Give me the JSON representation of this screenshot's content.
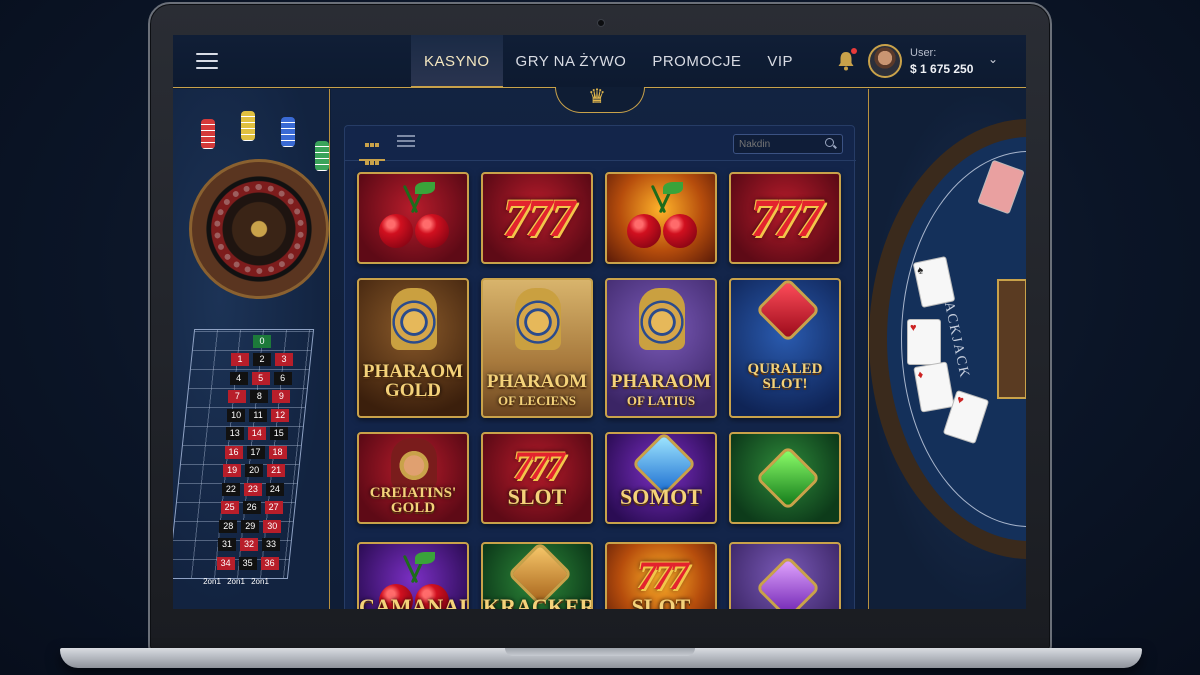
{
  "header": {
    "nav": [
      {
        "label": "KASYNO",
        "active": true
      },
      {
        "label": "GRY NA ŻYWO",
        "active": false
      },
      {
        "label": "PROMOCJE",
        "active": false
      },
      {
        "label": "VIP",
        "active": false
      }
    ],
    "user_label": "User:",
    "balance": "$ 1 675 250"
  },
  "toolbar": {
    "search_placeholder": "Nakdin"
  },
  "left_table": {
    "zero": "0",
    "numbers": [
      "1",
      "2",
      "3",
      "4",
      "5",
      "6",
      "7",
      "8",
      "9",
      "10",
      "11",
      "12",
      "13",
      "14",
      "15",
      "16",
      "17",
      "18",
      "19",
      "20",
      "21",
      "22",
      "23",
      "24",
      "25",
      "26",
      "27",
      "28",
      "29",
      "30",
      "31",
      "32",
      "33",
      "34",
      "35",
      "36"
    ],
    "bottom": [
      "2on1",
      "2on1",
      "2on1"
    ]
  },
  "right_table": {
    "label": "BLACKJACK"
  },
  "games": [
    {
      "title": "",
      "art": "cherries"
    },
    {
      "title": "",
      "art": "777"
    },
    {
      "title": "",
      "art": "cherries"
    },
    {
      "title": "",
      "art": "777"
    },
    {
      "title": "PHARAOM GOLD",
      "art": "pharaoh"
    },
    {
      "title": "PHARAOM",
      "subtitle": "OF LECIENS",
      "art": "pharaoh"
    },
    {
      "title": "PHARAOM",
      "subtitle": "OF LATIUS",
      "art": "pharaoh"
    },
    {
      "title": "QURALED SLOT!",
      "art": "heart-gem"
    },
    {
      "title": "CREIATINS' GOLD",
      "art": "king"
    },
    {
      "title": "SLOT",
      "art": "777"
    },
    {
      "title": "SOMOT",
      "art": "diamond"
    },
    {
      "title": "",
      "art": "emerald"
    },
    {
      "title": "CAMANALOT",
      "art": "fruit"
    },
    {
      "title": "KRACKER",
      "art": "lion"
    },
    {
      "title": "SLOT",
      "art": "777"
    },
    {
      "title": "",
      "art": "amethyst"
    }
  ],
  "colors": {
    "accent_gold": "#c9a24a",
    "background_navy": "#0f1d34",
    "notification_dot": "#e83a3a"
  },
  "icons": [
    "hamburger-menu-icon",
    "bell-icon",
    "grid-view-icon",
    "list-view-icon",
    "search-icon",
    "chevron-down-icon",
    "crown-icon"
  ]
}
